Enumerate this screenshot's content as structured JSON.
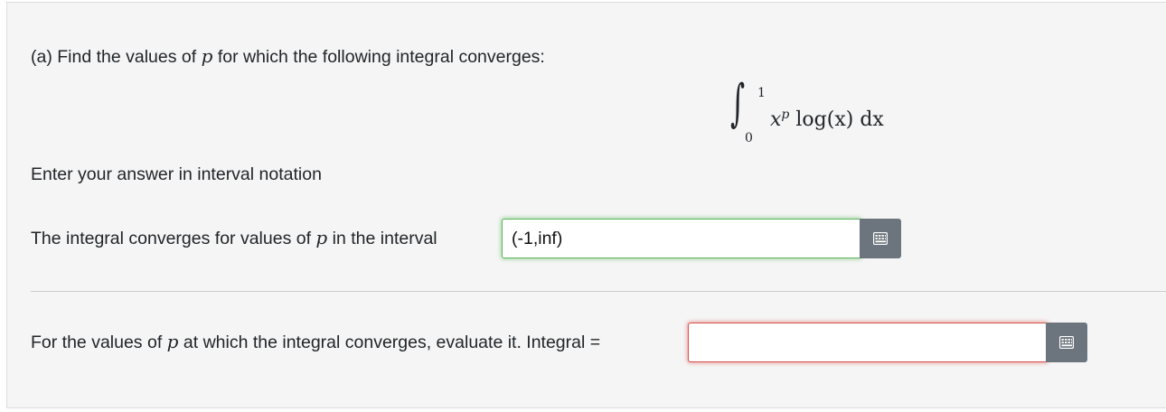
{
  "part_a": {
    "prompt_before": "(a) Find the values of ",
    "variable": "p",
    "prompt_after": " for which the following integral converges:",
    "equation": {
      "upper_limit": "1",
      "lower_limit": "0",
      "integrand_base": "x",
      "integrand_exponent": "p",
      "integrand_rest": " log(x) dx"
    },
    "instruction": "Enter your answer in interval notation",
    "interval_label_before": "The integral converges for values of ",
    "interval_label_after": " in the interval",
    "interval_answer": "(-1,inf)",
    "interval_status": "correct",
    "eval_label_before": "For the values of ",
    "eval_label_after": " at which the integral converges, evaluate it. Integral =",
    "eval_answer": "",
    "eval_status": "incorrect"
  },
  "icons": {
    "keyboard": "calculator-grid-icon"
  },
  "colors": {
    "correct": "#5cb85c",
    "incorrect": "#d9534f",
    "button": "#6c757d"
  }
}
